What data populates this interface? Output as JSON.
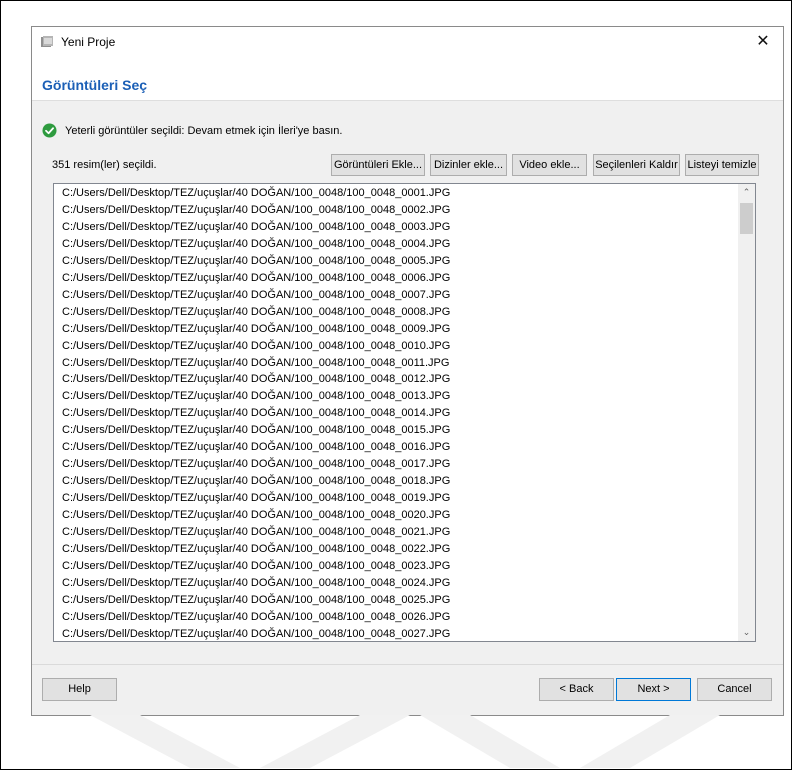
{
  "window": {
    "title": "Yeni Proje",
    "close_symbol": "✕"
  },
  "page": {
    "title": "Görüntüleri Seç"
  },
  "status": {
    "icon": "check-circle-icon",
    "icon_color": "#2e9b3f",
    "text": "Yeterli görüntüler seçildi: Devam etmek için İleri'ye basın."
  },
  "selection": {
    "count_text": "351 resim(ler) seçildi."
  },
  "toolbar": {
    "add_images": "Görüntüleri Ekle...",
    "add_folders": "Dizinler ekle...",
    "add_video": "Video ekle...",
    "remove_selected": "Seçilenleri Kaldır",
    "clear_list": "Listeyi temizle"
  },
  "files": [
    "C:/Users/Dell/Desktop/TEZ/uçuşlar/40 DOĞAN/100_0048/100_0048_0001.JPG",
    "C:/Users/Dell/Desktop/TEZ/uçuşlar/40 DOĞAN/100_0048/100_0048_0002.JPG",
    "C:/Users/Dell/Desktop/TEZ/uçuşlar/40 DOĞAN/100_0048/100_0048_0003.JPG",
    "C:/Users/Dell/Desktop/TEZ/uçuşlar/40 DOĞAN/100_0048/100_0048_0004.JPG",
    "C:/Users/Dell/Desktop/TEZ/uçuşlar/40 DOĞAN/100_0048/100_0048_0005.JPG",
    "C:/Users/Dell/Desktop/TEZ/uçuşlar/40 DOĞAN/100_0048/100_0048_0006.JPG",
    "C:/Users/Dell/Desktop/TEZ/uçuşlar/40 DOĞAN/100_0048/100_0048_0007.JPG",
    "C:/Users/Dell/Desktop/TEZ/uçuşlar/40 DOĞAN/100_0048/100_0048_0008.JPG",
    "C:/Users/Dell/Desktop/TEZ/uçuşlar/40 DOĞAN/100_0048/100_0048_0009.JPG",
    "C:/Users/Dell/Desktop/TEZ/uçuşlar/40 DOĞAN/100_0048/100_0048_0010.JPG",
    "C:/Users/Dell/Desktop/TEZ/uçuşlar/40 DOĞAN/100_0048/100_0048_0011.JPG",
    "C:/Users/Dell/Desktop/TEZ/uçuşlar/40 DOĞAN/100_0048/100_0048_0012.JPG",
    "C:/Users/Dell/Desktop/TEZ/uçuşlar/40 DOĞAN/100_0048/100_0048_0013.JPG",
    "C:/Users/Dell/Desktop/TEZ/uçuşlar/40 DOĞAN/100_0048/100_0048_0014.JPG",
    "C:/Users/Dell/Desktop/TEZ/uçuşlar/40 DOĞAN/100_0048/100_0048_0015.JPG",
    "C:/Users/Dell/Desktop/TEZ/uçuşlar/40 DOĞAN/100_0048/100_0048_0016.JPG",
    "C:/Users/Dell/Desktop/TEZ/uçuşlar/40 DOĞAN/100_0048/100_0048_0017.JPG",
    "C:/Users/Dell/Desktop/TEZ/uçuşlar/40 DOĞAN/100_0048/100_0048_0018.JPG",
    "C:/Users/Dell/Desktop/TEZ/uçuşlar/40 DOĞAN/100_0048/100_0048_0019.JPG",
    "C:/Users/Dell/Desktop/TEZ/uçuşlar/40 DOĞAN/100_0048/100_0048_0020.JPG",
    "C:/Users/Dell/Desktop/TEZ/uçuşlar/40 DOĞAN/100_0048/100_0048_0021.JPG",
    "C:/Users/Dell/Desktop/TEZ/uçuşlar/40 DOĞAN/100_0048/100_0048_0022.JPG",
    "C:/Users/Dell/Desktop/TEZ/uçuşlar/40 DOĞAN/100_0048/100_0048_0023.JPG",
    "C:/Users/Dell/Desktop/TEZ/uçuşlar/40 DOĞAN/100_0048/100_0048_0024.JPG",
    "C:/Users/Dell/Desktop/TEZ/uçuşlar/40 DOĞAN/100_0048/100_0048_0025.JPG",
    "C:/Users/Dell/Desktop/TEZ/uçuşlar/40 DOĞAN/100_0048/100_0048_0026.JPG",
    "C:/Users/Dell/Desktop/TEZ/uçuşlar/40 DOĞAN/100_0048/100_0048_0027.JPG"
  ],
  "scrollbar": {
    "up_icon": "chevron-up-icon",
    "down_icon": "chevron-down-icon",
    "up_symbol": "⌃",
    "down_symbol": "⌄"
  },
  "footer": {
    "help": "Help",
    "back": "< Back",
    "next": "Next >",
    "cancel": "Cancel"
  }
}
